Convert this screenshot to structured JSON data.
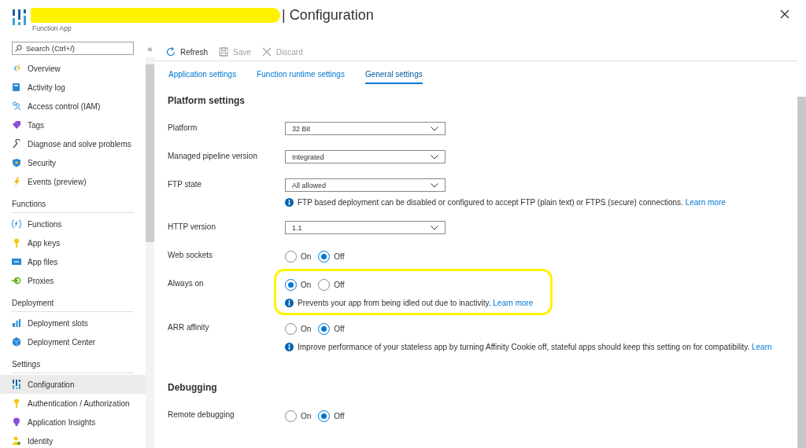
{
  "header": {
    "redacted": true,
    "title": "| Configuration",
    "subtitle": "Function App"
  },
  "sidebar": {
    "search_placeholder": "Search (Ctrl+/)",
    "collapse": "«",
    "groups": [
      {
        "items": [
          {
            "label": "Overview",
            "selected": false
          },
          {
            "label": "Activity log",
            "selected": false
          },
          {
            "label": "Access control (IAM)",
            "selected": false
          },
          {
            "label": "Tags",
            "selected": false
          },
          {
            "label": "Diagnose and solve problems",
            "selected": false
          },
          {
            "label": "Security",
            "selected": false
          },
          {
            "label": "Events (preview)",
            "selected": false
          }
        ]
      },
      {
        "heading": "Functions",
        "items": [
          {
            "label": "Functions",
            "selected": false
          },
          {
            "label": "App keys",
            "selected": false
          },
          {
            "label": "App files",
            "selected": false
          },
          {
            "label": "Proxies",
            "selected": false
          }
        ]
      },
      {
        "heading": "Deployment",
        "items": [
          {
            "label": "Deployment slots",
            "selected": false
          },
          {
            "label": "Deployment Center",
            "selected": false
          }
        ]
      },
      {
        "heading": "Settings",
        "items": [
          {
            "label": "Configuration",
            "selected": true
          },
          {
            "label": "Authentication / Authorization",
            "selected": false
          },
          {
            "label": "Application Insights",
            "selected": false
          },
          {
            "label": "Identity",
            "selected": false
          }
        ]
      }
    ]
  },
  "toolbar": [
    {
      "label": "Refresh",
      "disabled": false
    },
    {
      "label": "Save",
      "disabled": true
    },
    {
      "label": "Discard",
      "disabled": true
    }
  ],
  "tabs": [
    {
      "label": "Application settings",
      "selected": false
    },
    {
      "label": "Function runtime settings",
      "selected": false
    },
    {
      "label": "General settings",
      "selected": true
    }
  ],
  "sections": [
    {
      "heading": "Platform settings",
      "fields": [
        {
          "kind": "dropdown",
          "label": "Platform",
          "value": "32 Bit"
        },
        {
          "kind": "dropdown",
          "label": "Managed pipeline version",
          "value": "Integrated"
        },
        {
          "kind": "dropdown",
          "label": "FTP state",
          "value": "All allowed",
          "info": {
            "text": "FTP based deployment can be disabled or configured to accept FTP (plain text) or FTPS (secure) connections.",
            "link": "Learn more"
          }
        },
        {
          "kind": "dropdown",
          "label": "HTTP version",
          "value": "1.1"
        },
        {
          "kind": "radio",
          "label": "Web sockets",
          "options": [
            {
              "label": "On",
              "selected": false
            },
            {
              "label": "Off",
              "selected": true
            }
          ]
        },
        {
          "kind": "radio",
          "label": "Always on",
          "highlighted": true,
          "options": [
            {
              "label": "On",
              "selected": true
            },
            {
              "label": "Off",
              "selected": false
            }
          ],
          "info": {
            "text": "Prevents your app from being idled out due to inactivity.",
            "link": "Learn more"
          }
        },
        {
          "kind": "radio",
          "label": "ARR affinity",
          "options": [
            {
              "label": "On",
              "selected": false
            },
            {
              "label": "Off",
              "selected": true
            }
          ],
          "info": {
            "text": "Improve performance of your stateless app by turning Affinity Cookie off, stateful apps should keep this setting on for compatibility.",
            "link": "Learn"
          }
        }
      ]
    },
    {
      "heading": "Debugging",
      "fields": [
        {
          "kind": "radio",
          "label": "Remote debugging",
          "options": [
            {
              "label": "On",
              "selected": false
            },
            {
              "label": "Off",
              "selected": true
            }
          ]
        }
      ]
    }
  ]
}
